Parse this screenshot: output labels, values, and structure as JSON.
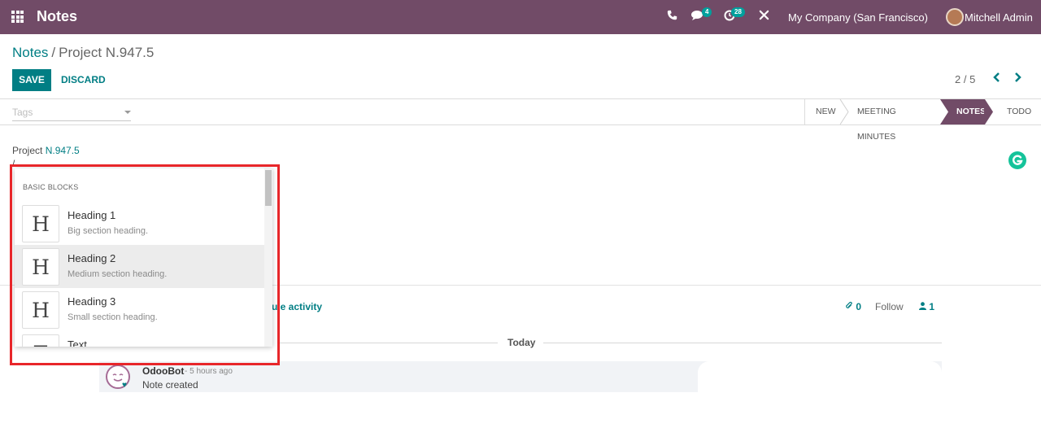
{
  "navbar": {
    "app_name": "Notes",
    "chat_badge": "4",
    "activity_badge": "28",
    "company": "My Company (San Francisco)",
    "user": "Mitchell Admin"
  },
  "breadcrumb": {
    "parent": "Notes",
    "separator": "/",
    "current": "Project N.947.5"
  },
  "buttons": {
    "save": "SAVE",
    "discard": "DISCARD"
  },
  "pager": {
    "value": "2 / 5",
    "prev": "‹",
    "next": "›"
  },
  "tags": {
    "placeholder": "Tags"
  },
  "stages": [
    "NEW",
    "MEETING MINUTES",
    "NOTES",
    "TODO"
  ],
  "active_stage": "NOTES",
  "note": {
    "prefix": "Project ",
    "link": "N.947.5",
    "command": "/"
  },
  "powerbox": {
    "header": "BASIC BLOCKS",
    "items": [
      {
        "icon": "H",
        "title": "Heading 1",
        "desc": "Big section heading."
      },
      {
        "icon": "H",
        "title": "Heading 2",
        "desc": "Medium section heading."
      },
      {
        "icon": "H",
        "title": "Heading 3",
        "desc": "Small section heading."
      },
      {
        "icon": "T",
        "title": "Text",
        "desc": ""
      }
    ]
  },
  "chatter": {
    "schedule_activity": "edule activity",
    "attachments": "0",
    "follow": "Follow",
    "followers": "1",
    "today": "Today",
    "message": {
      "author": "OdooBot",
      "time": "- 5 hours ago",
      "body": "Note created"
    }
  },
  "colors": {
    "brand": "#714b67",
    "accent": "#017e84",
    "highlight": "#e8262a"
  }
}
